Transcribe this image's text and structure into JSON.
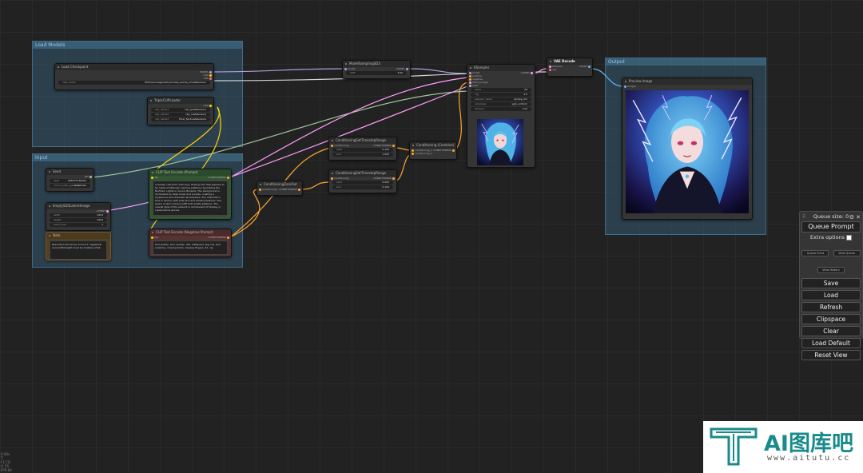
{
  "groups": {
    "load_models": "Load Models",
    "input": "Input",
    "output": "Output"
  },
  "nodes": {
    "checkpoint": {
      "title": "Load Checkpoint",
      "outputs": [
        "MODEL",
        "CLIP",
        "VAE"
      ],
      "ckpt_name_label": "ckpt_name",
      "ckpt_name_value": "SDXL\\Animagine\\XL\\(model)_anime_v3.safetensors"
    },
    "triple_clip": {
      "title": "TripleCLIPLoader",
      "output": "CLIP",
      "widgets": [
        {
          "label": "clip_name1",
          "value": "clip_g.safetensors"
        },
        {
          "label": "clip_name2",
          "value": "clip_l.safetensors"
        },
        {
          "label": "clip_name3",
          "value": "t5xxl_fp16.safetensors"
        }
      ]
    },
    "model_sampling": {
      "title": "ModelSamplingSD3",
      "input": "model",
      "output": "MODEL",
      "shift_label": "shift",
      "shift_value": "3.00"
    },
    "ksampler": {
      "title": "KSampler",
      "inputs": [
        "model",
        "positive",
        "negative",
        "latent_image",
        "seed"
      ],
      "output": "LATENT",
      "widgets": [
        {
          "label": "steps",
          "value": "28"
        },
        {
          "label": "cfg",
          "value": "4.5"
        },
        {
          "label": "sampler_name",
          "value": "dpmpp_2m"
        },
        {
          "label": "scheduler",
          "value": "sgm_uniform"
        },
        {
          "label": "denoise",
          "value": "1.00"
        }
      ]
    },
    "vae_decode": {
      "title": "VAE Decode",
      "inputs": [
        "samples",
        "vae"
      ],
      "output": "IMAGE"
    },
    "preview": {
      "title": "Preview Image",
      "input": "images"
    },
    "seed": {
      "title": "Seed",
      "output": "INT",
      "widgets": [
        {
          "label": "seed",
          "value": "698372738162"
        },
        {
          "label": "control_after_generate",
          "value": "randomize"
        }
      ]
    },
    "empty_latent": {
      "title": "EmptySD3LatentImage",
      "output": "LATENT",
      "widgets": [
        {
          "label": "width",
          "value": "1024"
        },
        {
          "label": "height",
          "value": "1024"
        },
        {
          "label": "batch_size",
          "value": "1"
        }
      ]
    },
    "note": {
      "title": "Note",
      "text": "Resolution should be around 1 megapixel and width/height must be multiple of 64"
    },
    "clip_pos": {
      "title": "CLIP Text Encode (Prompt)",
      "input": "clip",
      "output": "CONDITIONING",
      "text": "a female character with long, flowing hair that appears to be made of ethereal, swirling patterns resembling the Northern Lights or Aurora Borealis. The background is dominated by deep blues and purples, creating a mysterious and dramatic atmosphere. The character's face is serene, with pale skin and striking features. She wears a dark-colored outfit with subtle patterns. The overall style of the artwork is reminiscent of fantasy or supernatural genres"
    },
    "clip_neg": {
      "title": "CLIP Text Encode (Negative Prompt)",
      "input": "clip",
      "output": "CONDITIONING",
      "text": "bad quality, poor quality, doll, disfigured, jpg, toy, bad anatomy, missing limbs, missing fingers, 3d, cgi"
    },
    "zero_out": {
      "title": "ConditioningZeroOut",
      "input": "conditioning",
      "output": "CONDITIONING"
    },
    "cond_range1": {
      "title": "ConditioningSetTimestepRange",
      "input": "conditioning",
      "output": "CONDITIONING",
      "widgets": [
        {
          "label": "start",
          "value": "0.100"
        },
        {
          "label": "end",
          "value": "1.000"
        }
      ]
    },
    "cond_range2": {
      "title": "ConditioningSetTimestepRange",
      "input": "conditioning",
      "output": "CONDITIONING",
      "widgets": [
        {
          "label": "start",
          "value": "0.000"
        },
        {
          "label": "end",
          "value": "0.100"
        }
      ]
    },
    "cond_combine": {
      "title": "Conditioning (Combine)",
      "inputs": [
        "conditioning_1",
        "conditioning_2"
      ],
      "output": "CONDITIONING"
    }
  },
  "panel": {
    "queue_size": "Queue size: 0",
    "queue_prompt": "Queue Prompt",
    "extra_options": "Extra options",
    "queue_front": "Queue Front",
    "view_queue": "View Queue",
    "view_history": "View History",
    "buttons": [
      "Save",
      "Load",
      "Refresh",
      "Clipspace",
      "Clear",
      "Load Default",
      "Reset View"
    ]
  },
  "stats": [
    "0.00s",
    "T:",
    "I:1 [1]",
    "V: 55",
    "FPS:60"
  ],
  "watermark": {
    "brand": "AI图库吧",
    "url": "www.aitutu.cc"
  },
  "colors": {
    "link_model": "#b39ddb",
    "link_clip": "#ffd500",
    "link_cond": "#ffa931",
    "link_latent": "#ff9cf9",
    "link_vae": "#ff6e6e",
    "link_int": "#a0c8a0",
    "link_image": "#64b5f6",
    "watermark_teal": "#1a8a8a"
  }
}
